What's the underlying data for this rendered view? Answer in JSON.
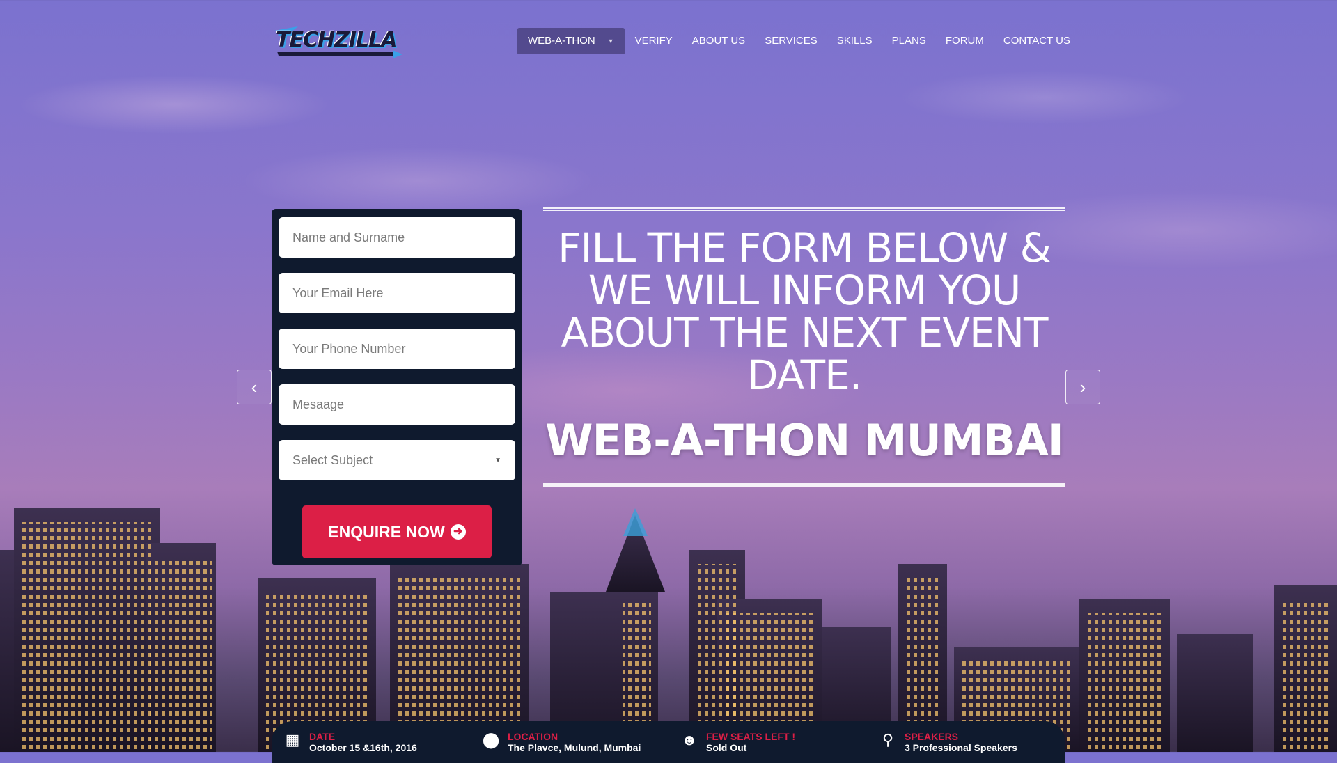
{
  "header": {
    "logo_text": "TECHZILLA",
    "nav": [
      {
        "label": "WEB-A-THON",
        "active": true,
        "has_dropdown": true
      },
      {
        "label": "VERIFY"
      },
      {
        "label": "ABOUT US"
      },
      {
        "label": "SERVICES"
      },
      {
        "label": "SKILLS"
      },
      {
        "label": "PLANS"
      },
      {
        "label": "FORUM"
      },
      {
        "label": "CONTACT US"
      }
    ]
  },
  "form": {
    "name_placeholder": "Name and Surname",
    "email_placeholder": "Your Email Here",
    "phone_placeholder": "Your Phone Number",
    "message_placeholder": "Mesaage",
    "subject_placeholder": "Select Subject",
    "submit_label": "ENQUIRE NOW"
  },
  "hero": {
    "subtitle": "FILL THE FORM BELOW & WE WILL INFORM YOU ABOUT THE NEXT EVENT DATE.",
    "title": "WEB-A-THON MUMBAI"
  },
  "slider": {
    "prev_icon": "chevron-left-icon",
    "next_icon": "chevron-right-icon"
  },
  "info": [
    {
      "icon": "calendar-icon",
      "label": "DATE",
      "value": "October 15 &16th, 2016"
    },
    {
      "icon": "map-marker-icon",
      "label": "LOCATION",
      "value": "The Plavce, Mulund, Mumbai"
    },
    {
      "icon": "users-icon",
      "label": "FEW SEATS LEFT !",
      "value": "Sold Out"
    },
    {
      "icon": "microphone-icon",
      "label": "SPEAKERS",
      "value": "3 Professional Speakers"
    }
  ],
  "colors": {
    "accent": "#dc1f46",
    "panel": "#0f1a2e",
    "nav_active_bg": "#463c78"
  }
}
